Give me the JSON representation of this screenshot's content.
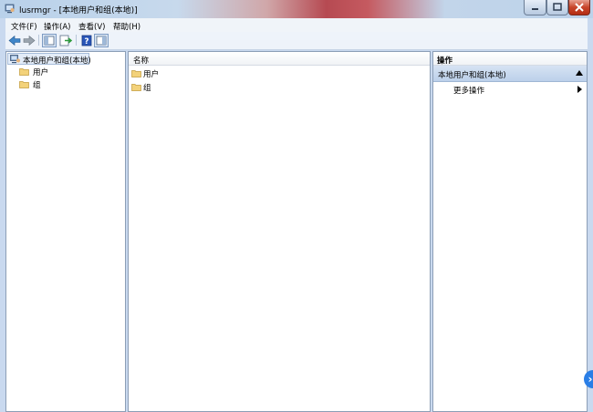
{
  "window": {
    "title": "lusrmgr - [本地用户和组(本地)]",
    "icon": "computer-users-icon",
    "controls": [
      "minimize-icon",
      "maximize-icon",
      "close-icon"
    ]
  },
  "menu": {
    "file": "文件(F)",
    "action": "操作(A)",
    "view": "查看(V)",
    "help": "帮助(H)"
  },
  "toolbar": {
    "buttons": [
      "back-icon",
      "forward-icon",
      "show-hide-tree-icon",
      "export-list-icon",
      "help-icon",
      "show-hide-action-pane-icon"
    ]
  },
  "tree": {
    "root": "本地用户和组(本地)",
    "children": [
      "用户",
      "组"
    ]
  },
  "content": {
    "column_header": "名称",
    "items": [
      "用户",
      "组"
    ]
  },
  "actions": {
    "header": "操作",
    "section": "本地用户和组(本地)",
    "more": "更多操作"
  },
  "colors": {
    "titlebar_accent": "#b64a52",
    "section_bg": "#bcd0ea",
    "folder": "#f3d27a"
  }
}
